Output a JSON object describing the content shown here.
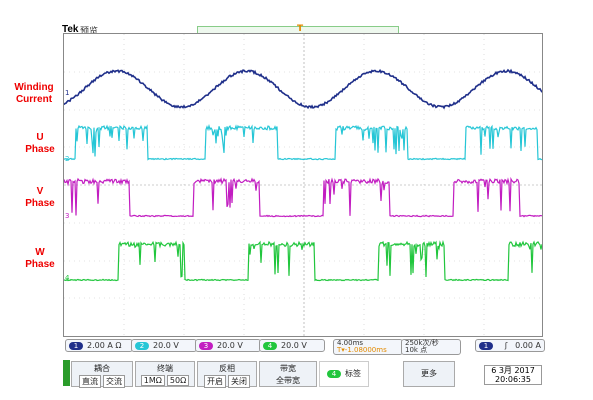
{
  "header": {
    "brand": "Tek",
    "brand_sub": "预览"
  },
  "labels": {
    "winding": "Winding\nCurrent",
    "u_phase": "U\nPhase",
    "v_phase": "V\nPhase",
    "w_phase": "W\nPhase"
  },
  "colors": {
    "ch1": "#1f2f8a",
    "ch2": "#26c6d6",
    "ch3": "#c21dc1",
    "ch4": "#21c63d",
    "label_red": "#e00000"
  },
  "status": {
    "ch1": "2.00 A  Ω",
    "ch2": "20.0 V",
    "ch3": "20.0 V",
    "ch4": "20.0 V",
    "timebase": "4.00ms",
    "timeoffset": "T▾-1.08000ms",
    "samplerate": "250k次/秒",
    "points": "10k 点",
    "trigger": "0.00 A"
  },
  "menu": {
    "coupling_title": "耦合",
    "coupling_opts": [
      "直流",
      "交流"
    ],
    "termination_title": "终端",
    "termination_opts": [
      "1MΩ",
      "50Ω"
    ],
    "invert_title": "反相",
    "invert_opts": [
      "开启",
      "关闭"
    ],
    "bandwidth_title": "带宽",
    "bandwidth_value": "全带宽",
    "label_button": "标签",
    "more_button": "更多",
    "date": "6 3月 2017",
    "time": "20:06:35"
  },
  "channel_markers": [
    "1",
    "2",
    "3",
    "4"
  ],
  "trigger_marker": "T"
}
